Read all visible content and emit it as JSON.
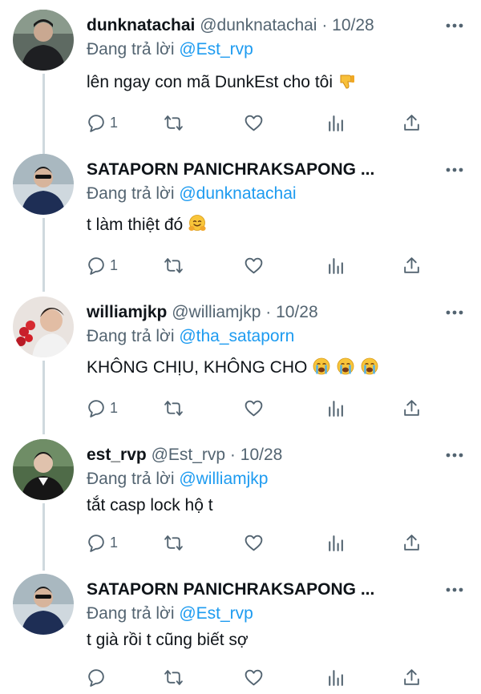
{
  "tweets": [
    {
      "name": "dunknatachai",
      "handle": "@dunknatachai",
      "dot": "·",
      "date": "10/28",
      "reply_prefix": "Đang trả lời ",
      "reply_to": "@Est_rvp",
      "text": "lên ngay con mã DunkEst cho tôi",
      "emojis": [
        "thumbs-down-emoji"
      ],
      "reply_count": "1"
    },
    {
      "name": "SATAPORN PANICHRAKSAPONG ...",
      "handle": "",
      "dot": "",
      "date": "",
      "reply_prefix": "Đang trả lời ",
      "reply_to": "@dunknatachai",
      "text": "t làm thiệt đó",
      "emojis": [
        "hugging-face-emoji"
      ],
      "reply_count": "1"
    },
    {
      "name": "williamjkp",
      "handle": "@williamjkp",
      "dot": "·",
      "date": "10/28",
      "reply_prefix": "Đang trả lời ",
      "reply_to": "@tha_sataporn",
      "text": "KHÔNG CHỊU, KHÔNG CHO",
      "emojis": [
        "crying-face-emoji",
        "crying-face-emoji",
        "crying-face-emoji"
      ],
      "reply_count": "1"
    },
    {
      "name": "est_rvp",
      "handle": "@Est_rvp",
      "dot": "·",
      "date": "10/28",
      "reply_prefix": "Đang trả lời ",
      "reply_to": "@williamjkp",
      "text": "tắt casp lock hộ t",
      "emojis": [],
      "reply_count": "1"
    },
    {
      "name": "SATAPORN PANICHRAKSAPONG ...",
      "handle": "",
      "dot": "",
      "date": "",
      "reply_prefix": "Đang trả lời ",
      "reply_to": "@Est_rvp",
      "text": "t già rồi t cũng biết sợ",
      "emojis": [],
      "reply_count": ""
    }
  ],
  "icons": {
    "reply": "reply-icon",
    "retweet": "retweet-icon",
    "like": "heart-icon",
    "stats": "analytics-icon",
    "share": "share-icon",
    "more": "more-options-icon"
  },
  "colors": {
    "link": "#1d9bf0",
    "secondary": "#536471",
    "text": "#0f1419",
    "thread_line": "#cfd9de"
  }
}
